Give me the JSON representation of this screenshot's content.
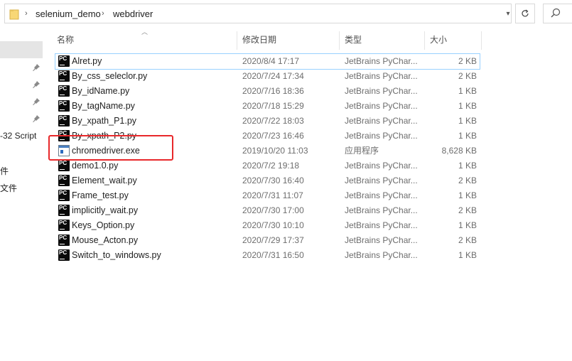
{
  "address": {
    "crumbs": [
      "selenium_demo",
      "webdriver"
    ],
    "search_placeholder": ""
  },
  "nav": {
    "items": [
      "-32 Script",
      "件",
      "文件"
    ]
  },
  "columns": {
    "name": "名称",
    "date": "修改日期",
    "type": "类型",
    "size": "大小"
  },
  "files": [
    {
      "name": "Alret.py",
      "date": "2020/8/4 17:17",
      "type": "JetBrains PyChar...",
      "size": "2 KB",
      "icon": "pycharm-file-icon"
    },
    {
      "name": "By_css_seleclor.py",
      "date": "2020/7/24 17:34",
      "type": "JetBrains PyChar...",
      "size": "2 KB",
      "icon": "pycharm-file-icon"
    },
    {
      "name": "By_idName.py",
      "date": "2020/7/16 18:36",
      "type": "JetBrains PyChar...",
      "size": "1 KB",
      "icon": "pycharm-file-icon"
    },
    {
      "name": "By_tagName.py",
      "date": "2020/7/18 15:29",
      "type": "JetBrains PyChar...",
      "size": "1 KB",
      "icon": "pycharm-file-icon"
    },
    {
      "name": "By_xpath_P1.py",
      "date": "2020/7/22 18:03",
      "type": "JetBrains PyChar...",
      "size": "1 KB",
      "icon": "pycharm-file-icon"
    },
    {
      "name": "By_xpath_P2.py",
      "date": "2020/7/23 16:46",
      "type": "JetBrains PyChar...",
      "size": "1 KB",
      "icon": "pycharm-file-icon"
    },
    {
      "name": "chromedriver.exe",
      "date": "2019/10/20 11:03",
      "type": "应用程序",
      "size": "8,628 KB",
      "icon": "exe-file-icon"
    },
    {
      "name": "demo1.0.py",
      "date": "2020/7/2 19:18",
      "type": "JetBrains PyChar...",
      "size": "1 KB",
      "icon": "pycharm-file-icon"
    },
    {
      "name": "Element_wait.py",
      "date": "2020/7/30 16:40",
      "type": "JetBrains PyChar...",
      "size": "2 KB",
      "icon": "pycharm-file-icon"
    },
    {
      "name": "Frame_test.py",
      "date": "2020/7/31 11:07",
      "type": "JetBrains PyChar...",
      "size": "1 KB",
      "icon": "pycharm-file-icon"
    },
    {
      "name": "implicitly_wait.py",
      "date": "2020/7/30 17:00",
      "type": "JetBrains PyChar...",
      "size": "2 KB",
      "icon": "pycharm-file-icon"
    },
    {
      "name": "Keys_Option.py",
      "date": "2020/7/30 10:10",
      "type": "JetBrains PyChar...",
      "size": "1 KB",
      "icon": "pycharm-file-icon"
    },
    {
      "name": "Mouse_Acton.py",
      "date": "2020/7/29 17:37",
      "type": "JetBrains PyChar...",
      "size": "2 KB",
      "icon": "pycharm-file-icon"
    },
    {
      "name": "Switch_to_windows.py",
      "date": "2020/7/31 16:50",
      "type": "JetBrains PyChar...",
      "size": "1 KB",
      "icon": "pycharm-file-icon"
    }
  ],
  "colors": {
    "highlight": "#e8282b",
    "selection_border": "#99d1ff"
  }
}
